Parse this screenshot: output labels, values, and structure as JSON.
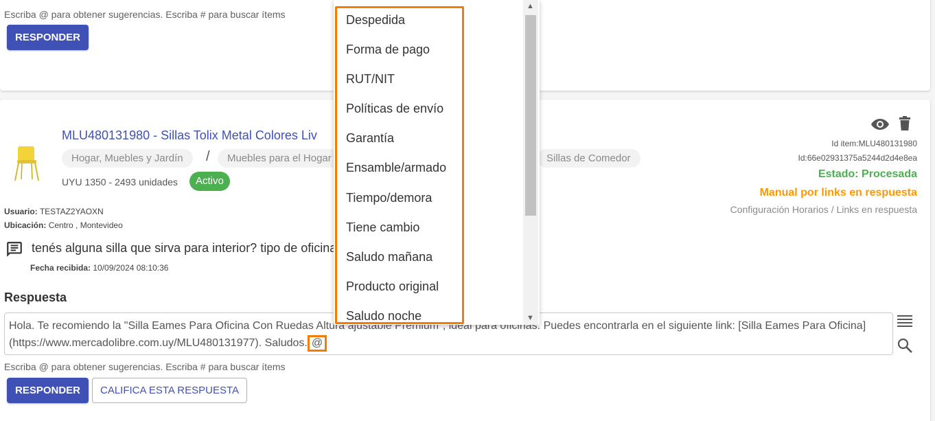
{
  "top_card": {
    "hint": "Escriba @ para obtener sugerencias. Escriba # para buscar ítems",
    "respond_label": "RESPONDER"
  },
  "item": {
    "title": "MLU480131980 - Sillas Tolix Metal Colores Liv",
    "breadcrumbs": [
      "Hogar, Muebles y Jardín",
      "Muebles para el Hogar",
      "Sillas de Comedor"
    ],
    "separator": "/",
    "price": "UYU 1350 - 2493 unidades",
    "badge": "Activo",
    "id_item": "Id item:MLU480131980",
    "id": "Id:66e02931375a5244d2d4e8ea",
    "status": "Estado: Procesada",
    "mode": "Manual por links en respuesta",
    "config": "Configuración Horarios / Links en respuesta",
    "user_label": "Usuario:",
    "user_value": "TESTAZ2YAOXN",
    "location_label": "Ubicación:",
    "location_value": "Centro , Montevideo",
    "question": "tenés alguna silla que sirva para interior? tipo de oficina",
    "date_label": "Fecha recibida:",
    "date_value": "10/09/2024 08:10:36",
    "answer_title": "Respuesta",
    "answer_line1": "Hola. Te recomiendo la \"Silla Eames Para Oficina Con Ruedas Altura ajustable Premium\", ideal para oficinas. Puedes encontrarla en el siguiente link: [Silla Eames Para Oficina]",
    "answer_line2": "(https://www.mercadolibre.com.uy/MLU480131977). Saludos.",
    "answer_at": "@",
    "hint": "Escriba @ para obtener sugerencias. Escriba # para buscar ítems",
    "respond_label": "RESPONDER",
    "rate_label": "CALIFICA ESTA RESPUESTA"
  },
  "dropdown": {
    "items": [
      "Despedida",
      "Forma de pago",
      "RUT/NIT",
      "Políticas de envío",
      "Garantía",
      "Ensamble/armado",
      "Tiempo/demora",
      "Tiene cambio",
      "Saludo mañana",
      "Producto original",
      "Saludo noche"
    ]
  },
  "colors": {
    "primary": "#3f51b5",
    "success": "#4caf50",
    "status_green": "#4caf50",
    "mode_orange": "#ff9800",
    "highlight": "#f57c00"
  }
}
